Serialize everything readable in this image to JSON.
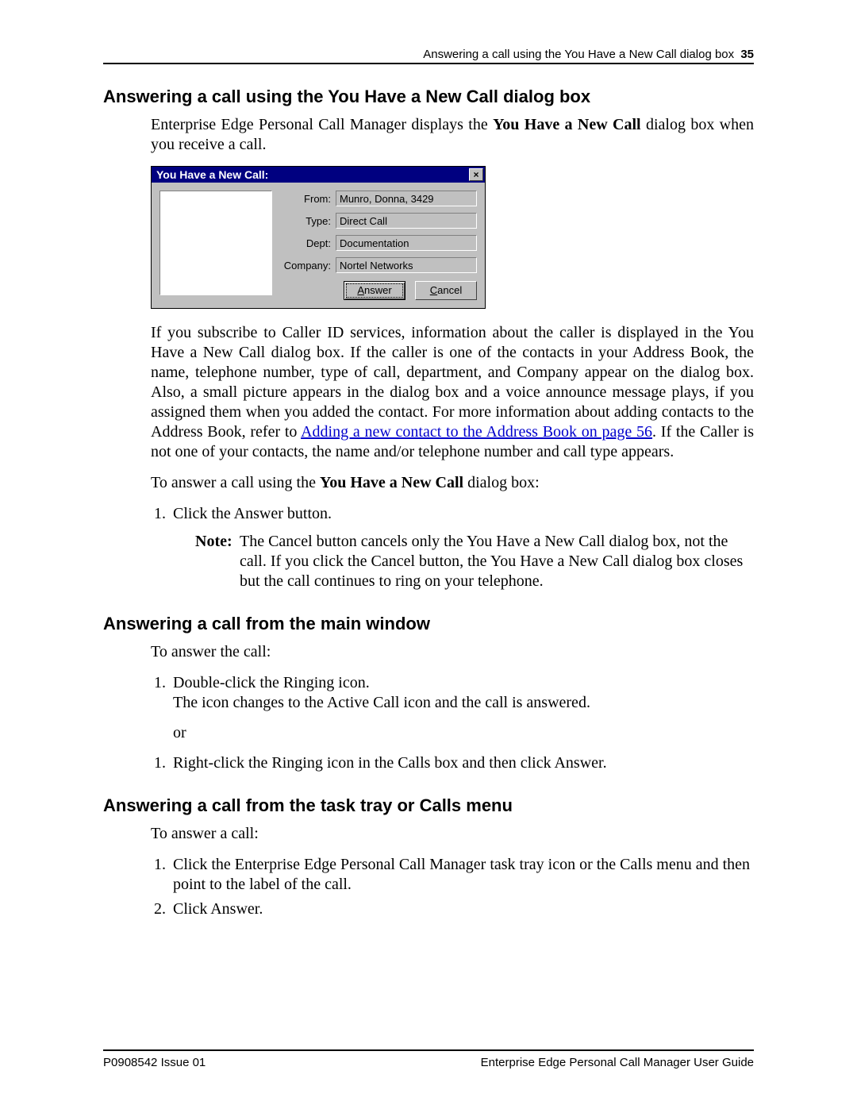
{
  "header": {
    "running_title": "Answering a call using the You Have a New Call dialog box",
    "page_number": "35"
  },
  "section1": {
    "heading": "Answering a call using the You Have a New Call dialog box",
    "intro_a": "Enterprise Edge Personal Call Manager displays the ",
    "intro_bold": "You Have a New Call",
    "intro_b": " dialog box when you receive a call.",
    "dialog": {
      "title": "You Have a New Call:",
      "fields": {
        "from_label": "From:",
        "from_value": "Munro, Donna, 3429",
        "type_label": "Type:",
        "type_value": "Direct Call",
        "dept_label": "Dept:",
        "dept_value": "Documentation",
        "company_label": "Company:",
        "company_value": "Nortel Networks"
      },
      "answer_btn": "Answer",
      "cancel_btn": "Cancel"
    },
    "para2_a": "If you subscribe to Caller ID services, information about the caller is displayed in the You Have a New Call dialog box. If the caller is one of the contacts in your Address Book, the name, telephone number, type of call, department, and Company appear on the dialog box. Also, a small picture appears in the dialog box and a voice announce message plays, if you assigned them when you added the contact. For more information about adding contacts to the Address Book, refer to ",
    "para2_link": "Adding a new contact to the Address Book on page 56",
    "para2_b": ". If the Caller is not one of your contacts, the name and/or telephone number and call type appears.",
    "para3_a": "To answer a call using the ",
    "para3_bold": "You Have a New Call",
    "para3_b": " dialog box:",
    "step1_a": "Click the ",
    "step1_bold": "Answer",
    "step1_b": " button.",
    "note_label": "Note:",
    "note_text": "The Cancel button cancels only the You Have a New Call dialog box, not the call. If you click the Cancel button, the You Have a New Call dialog box closes but the call continues to ring on your telephone."
  },
  "section2": {
    "heading": "Answering a call from the main window",
    "intro": "To answer the call:",
    "step1_line1": "Double-click the Ringing icon.",
    "step1_line2": "The icon changes to the Active Call icon and the call is answered.",
    "or": "or",
    "step2_a": "Right-click the Ringing icon in the Calls box and then click ",
    "step2_bold": "Answer",
    "step2_b": "."
  },
  "section3": {
    "heading": "Answering a call from the task tray or Calls menu",
    "intro": "To answer a call:",
    "step1_a": "Click the Enterprise Edge Personal Call Manager task tray icon or the ",
    "step1_bold": "Calls",
    "step1_b": " menu and then point to the label of the call.",
    "step2_a": "Click ",
    "step2_bold": "Answer",
    "step2_b": "."
  },
  "footer": {
    "left": "P0908542 Issue 01",
    "right": "Enterprise Edge Personal Call Manager User Guide"
  }
}
